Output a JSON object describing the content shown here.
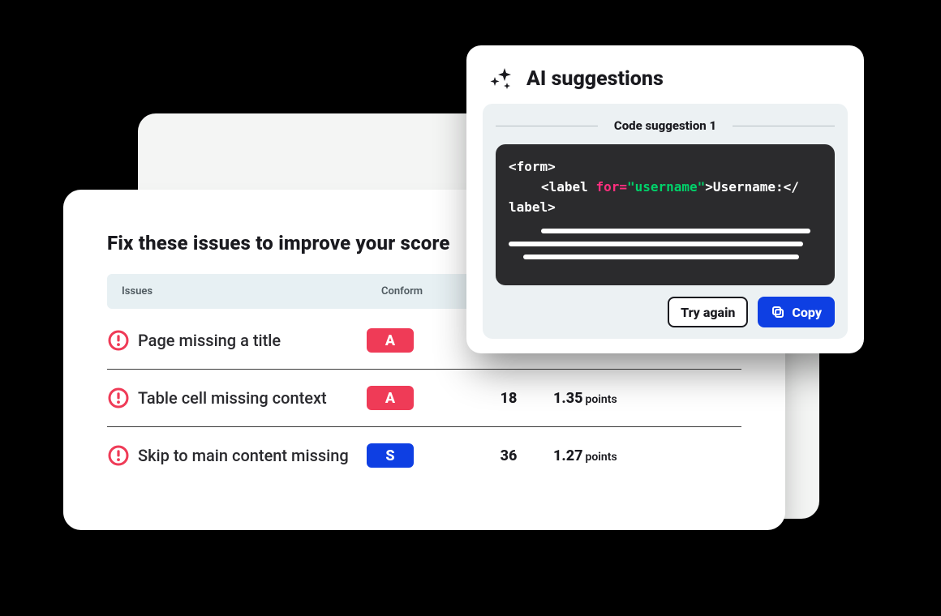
{
  "colors": {
    "accent_blue": "#0e3fe3",
    "danger_red": "#ef3b57",
    "code_bg": "#2b2b2d",
    "code_keyword": "#ff2f7e",
    "code_string": "#00d26a"
  },
  "issues_card": {
    "title": "Fix these issues to improve your score",
    "columns": {
      "issues": "Issues",
      "conformance": "Conform"
    },
    "points_unit": "points",
    "rows": [
      {
        "icon": "alert",
        "label": "Page missing a title",
        "conformance": "A",
        "conformance_color": "red",
        "count": null,
        "points": null
      },
      {
        "icon": "alert",
        "label": "Table cell missing context",
        "conformance": "A",
        "conformance_color": "red",
        "count": "18",
        "points": "1.35"
      },
      {
        "icon": "alert",
        "label": "Skip to main content missing",
        "conformance": "S",
        "conformance_color": "blue",
        "count": "36",
        "points": "1.27"
      }
    ]
  },
  "ai_card": {
    "title": "AI suggestions",
    "suggestion_label": "Code suggestion 1",
    "code": {
      "line1_prefix": "<form>",
      "line2_tag_open": "<label ",
      "line2_attr_name": "for=",
      "line2_attr_value": "\"username\"",
      "line2_tag_mid": ">Username:</",
      "line3_close": "label>"
    },
    "actions": {
      "try_again": "Try again",
      "copy": "Copy"
    }
  }
}
